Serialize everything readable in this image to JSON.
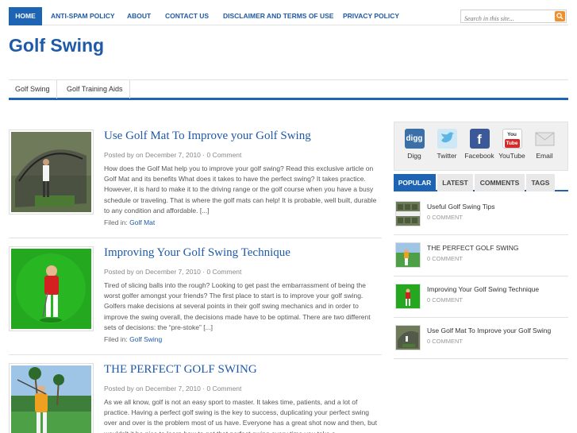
{
  "top_nav": {
    "items": [
      "Home",
      "Anti-Spam Policy",
      "About",
      "Contact Us",
      "Disclaimer and Terms of Use",
      "Privacy Policy"
    ],
    "search_placeholder": "Search in this site..."
  },
  "site": {
    "title": "Golf Swing"
  },
  "sub_nav": {
    "items": [
      "Golf Swing",
      "Golf Training Aids"
    ]
  },
  "posts": [
    {
      "title": "Use Golf Mat To Improve your Golf Swing",
      "meta": "Posted by on December 7, 2010 · 0 Comment",
      "excerpt": "How does the Golf Mat help you to improve your golf swing? Read this exclusive article on Golf Mat and its benefits What does it takes to have the perfect swing? It takes practice. However, it is hard to make it to the driving range or the golf course when you have a busy schedule or traveling. That is where the golf mats can help! It is probable, well built, durable to any condition and affordable. [...]",
      "filed_label": "Filed in:",
      "category": "Golf Mat"
    },
    {
      "title": "Improving Your Golf Swing Technique",
      "meta": "Posted by on December 7, 2010 · 0 Comment",
      "excerpt": "Tired of slicing balls into the rough? Looking to get past the embarrassment of being the worst golfer amongst your friends? The first place to start is to improve your golf swing. Golfers make decisions at several points in their golf swing mechanics and in order to improve the swing overall, the decisions made have to be optimal. There are two different sets of decisions: the “pre-stoke” [...]",
      "filed_label": "Filed in:",
      "category": "Golf Swing"
    },
    {
      "title": "THE PERFECT GOLF SWING",
      "meta": "Posted by on December 7, 2010 · 0 Comment",
      "excerpt": "As we all know, golf is not an easy sport to master. It takes time, patients, and a lot of practice. Having a perfect golf swing is the key to success, duplicating your perfect swing over and over is the problem most of us have. Everyone has a great shot now and then, but wouldn't it be nice to learn how to get that perfect swing every time you take a"
    }
  ],
  "social": [
    {
      "label": "Digg",
      "icon": "digg-icon",
      "color": "#3b6fa8"
    },
    {
      "label": "Twitter",
      "icon": "twitter-icon",
      "color": "#5bb6e6"
    },
    {
      "label": "Facebook",
      "icon": "facebook-icon",
      "color": "#3b5998"
    },
    {
      "label": "YouTube",
      "icon": "youtube-icon",
      "color": "#d42a2a"
    },
    {
      "label": "Email",
      "icon": "email-icon",
      "color": "#e0e0e0"
    }
  ],
  "tabs": [
    "Popular",
    "Latest",
    "Comments",
    "Tags"
  ],
  "sidebar_posts": [
    {
      "title": "Useful Golf Swing Tips",
      "comments": "0 Comment"
    },
    {
      "title": "THE PERFECT GOLF SWING",
      "comments": "0 Comment"
    },
    {
      "title": "Improving Your Golf Swing Technique",
      "comments": "0 Comment"
    },
    {
      "title": "Use Golf Mat To Improve your Golf Swing",
      "comments": "0 Comment"
    }
  ],
  "colors": {
    "accent": "#1e64b4",
    "link": "#1e5aa8",
    "search_button": "#f0902a"
  }
}
